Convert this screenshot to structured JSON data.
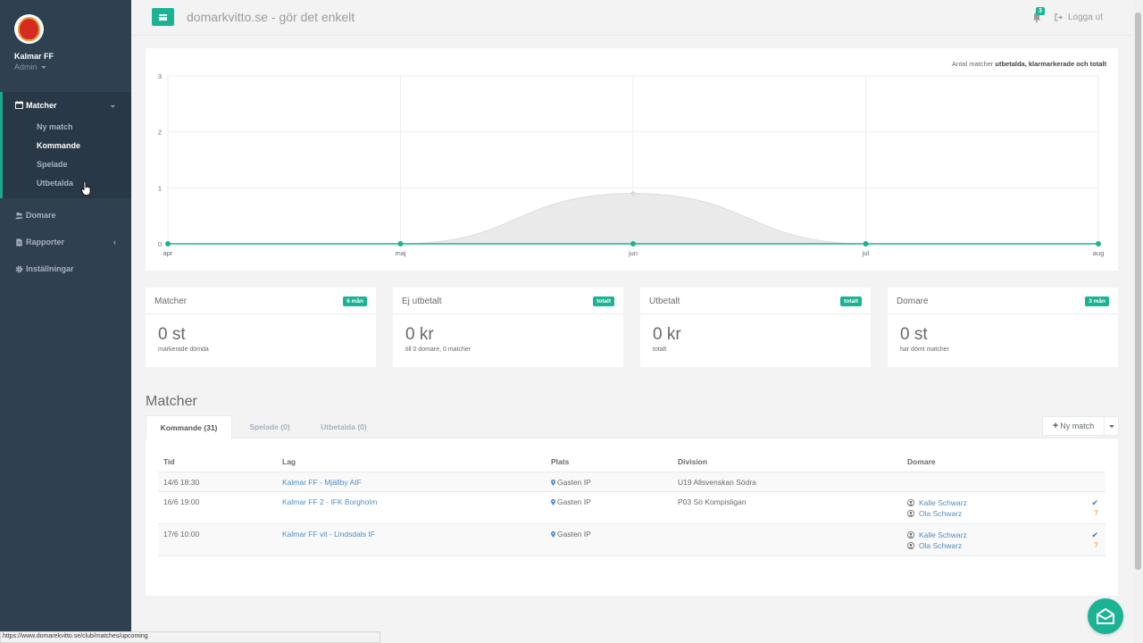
{
  "sidebar": {
    "club_name": "Kalmar FF",
    "role": "Admin",
    "nav": {
      "matcher": "Matcher",
      "matcher_sub": [
        "Ny match",
        "Kommande",
        "Spelade",
        "Utbetalda"
      ],
      "domare": "Domare",
      "rapporter": "Rapporter",
      "installningar": "Inställningar"
    }
  },
  "topbar": {
    "title": "domarkvitto.se - gör det enkelt",
    "notification_count": "3",
    "logout": "Logga ut"
  },
  "chart_caption": {
    "prefix": "Antal matcher ",
    "bold": "utbetalda, klarmarkerade och totalt"
  },
  "chart_data": {
    "type": "area",
    "x": [
      "apr",
      "maj",
      "jun",
      "jul",
      "aug"
    ],
    "series": [
      {
        "values": [
          0,
          0,
          0.9,
          0,
          0
        ],
        "color": "#dcdcdc"
      },
      {
        "values": [
          0,
          0,
          0,
          0,
          0
        ],
        "color": "#1ab394"
      }
    ],
    "ylim": [
      0,
      3
    ],
    "yticks": [
      "0",
      "1",
      "2",
      "3"
    ],
    "grid": true
  },
  "stats": [
    {
      "label": "Matcher",
      "badge": "6 mån",
      "value": "0 st",
      "sub": "markerade dömda"
    },
    {
      "label": "Ej utbetalt",
      "badge": "totalt",
      "value": "0 kr",
      "sub": "till 0 domare, 0 matcher"
    },
    {
      "label": "Utbetalt",
      "badge": "totalt",
      "value": "0 kr",
      "sub": "totalt"
    },
    {
      "label": "Domare",
      "badge": "3 mån",
      "value": "0 st",
      "sub": "har dömt matcher"
    }
  ],
  "matches_section": {
    "title": "Matcher",
    "tabs": [
      "Kommande (31)",
      "Spelade (0)",
      "Utbetalda (0)"
    ],
    "new_match_button": "Ny match",
    "columns": [
      "Tid",
      "Lag",
      "Plats",
      "Division",
      "Domare"
    ],
    "rows": [
      {
        "time": "14/6 18:30",
        "teams": "Kalmar FF - Mjällby AIF",
        "venue": "Gasten IP",
        "division": "U19 Allsvenskan Södra",
        "referees": []
      },
      {
        "time": "16/6 19:00",
        "teams": "Kalmar FF 2 - IFK Borgholm",
        "venue": "Gasten IP",
        "division": "P03 Sö Kompisligan",
        "referees": [
          "Kalle Schwarz",
          "Ola Schwarz"
        ]
      },
      {
        "time": "17/6 10:00",
        "teams": "Kalmar FF vit - Lindsdals IF",
        "venue": "Gasten IP",
        "division": "",
        "referees": [
          "Kalle Schwarz",
          "Ola Schwarz"
        ]
      }
    ],
    "status_marks": [
      "✔",
      "?"
    ]
  },
  "status_bar_url": "https://www.domarekvitto.se/club/matches/upcoming",
  "colors": {
    "sidebar": "#2f4050",
    "accent": "#1ab394",
    "link": "#337ab7"
  }
}
